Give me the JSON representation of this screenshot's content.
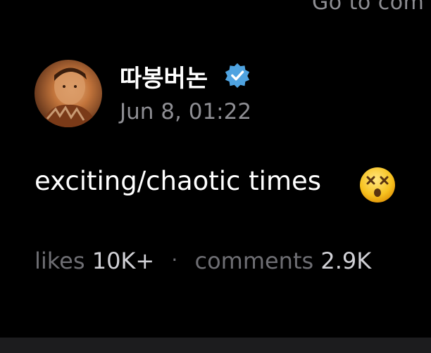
{
  "header": {
    "goto_label": "Go to com"
  },
  "post": {
    "username": "따봉버논",
    "verified": true,
    "timestamp": "Jun 8, 01:22",
    "text": "exciting/chaotic times",
    "emoji": "dizzy-face-emoji",
    "stats": {
      "likes_label": "likes",
      "likes_value": "10K+",
      "separator": "·",
      "comments_label": "comments",
      "comments_value": "2.9K"
    }
  },
  "colors": {
    "background": "#000000",
    "primary_text": "#ffffff",
    "secondary_text": "#8e8e93",
    "verified_badge": "#4fa3e0",
    "bottom_bar": "#1c1c1e"
  }
}
